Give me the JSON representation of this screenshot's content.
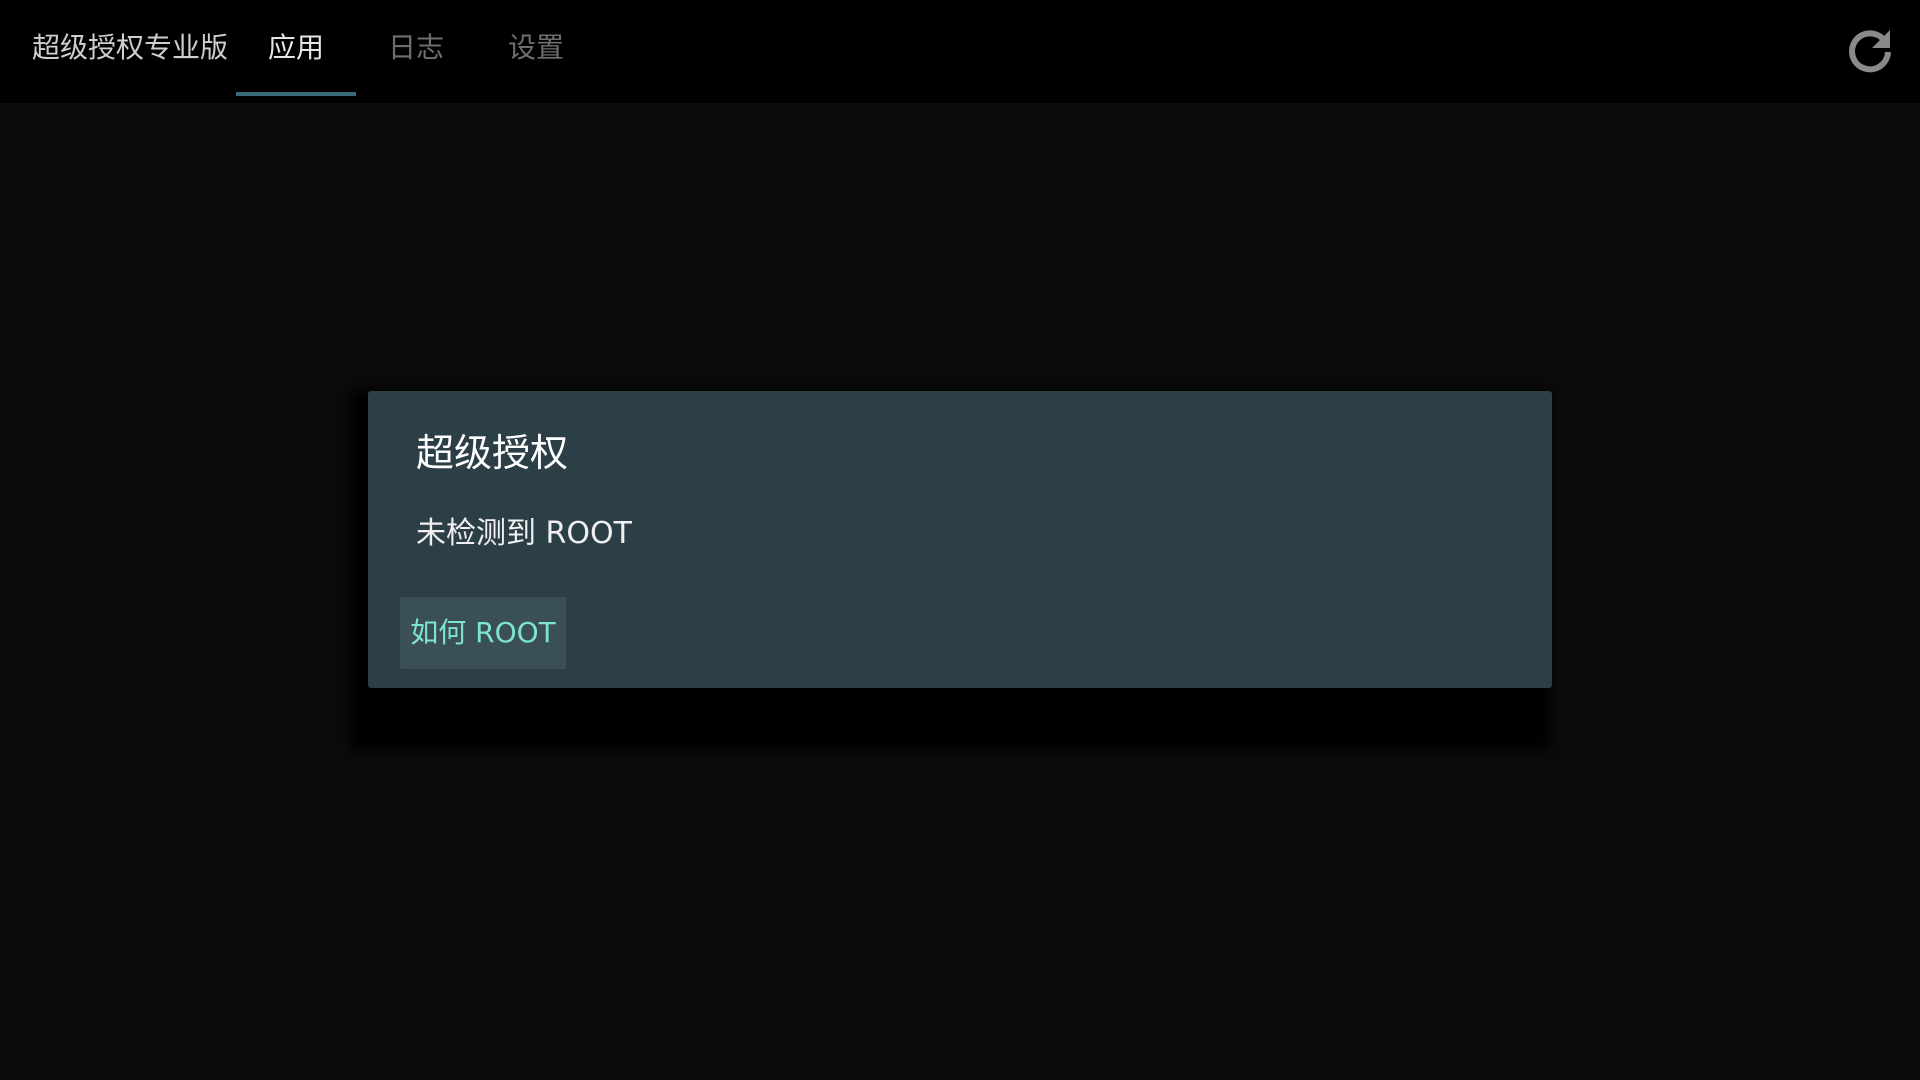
{
  "header": {
    "app_title": "超级授权专业版",
    "tabs": [
      {
        "label": "应用",
        "active": true
      },
      {
        "label": "日志",
        "active": false
      },
      {
        "label": "设置",
        "active": false
      }
    ],
    "refresh_icon": "refresh-icon"
  },
  "dialog": {
    "title": "超级授权",
    "message": "未检测到 ROOT",
    "button_label": "如何 ROOT"
  },
  "colors": {
    "background": "#0b0b0b",
    "topbar": "#000000",
    "dialog_background": "#2c3e46",
    "accent_text": "#7ee2d4",
    "tab_indicator": "#3b6a78"
  }
}
